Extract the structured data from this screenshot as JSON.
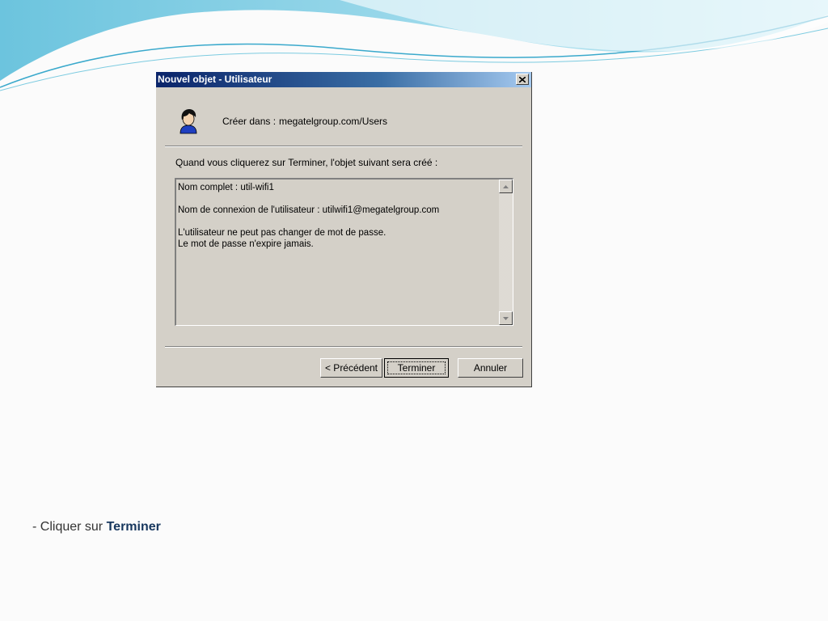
{
  "dialog": {
    "title": "Nouvel objet - Utilisateur",
    "close_icon": "close-x-icon",
    "header_icon": "user-icon",
    "create_label": "Créer dans :",
    "create_path": "megatelgroup.com/Users",
    "intro": "Quand vous cliquerez sur Terminer, l'objet suivant sera créé :",
    "summary_lines": [
      "Nom complet : util-wifi1",
      "",
      "Nom de connexion de l'utilisateur : utilwifi1@megatelgroup.com",
      "",
      "L'utilisateur ne peut pas changer de mot de passe.",
      "Le mot de passe n'expire jamais."
    ],
    "buttons": {
      "prev": "< Précédent",
      "finish": "Terminer",
      "cancel": "Annuler"
    }
  },
  "caption": {
    "prefix": "- Cliquer sur",
    "bold": "Terminer"
  },
  "colors": {
    "titlebar_start": "#0a246a",
    "dialog_bg": "#d4d0c8",
    "caption_bold": "#17375e"
  }
}
